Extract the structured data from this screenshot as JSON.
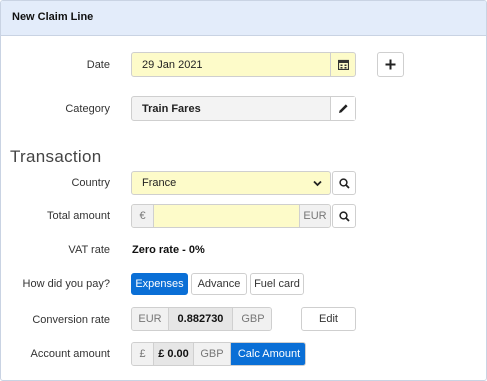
{
  "panel": {
    "title": "New Claim Line"
  },
  "date": {
    "label": "Date",
    "value": "29 Jan 2021",
    "calendar_icon": "calendar-icon",
    "add_icon": "plus-icon"
  },
  "category": {
    "label": "Category",
    "value": "Train Fares",
    "edit_icon": "pencil-icon"
  },
  "transaction": {
    "heading": "Transaction"
  },
  "country": {
    "label": "Country",
    "value": "France",
    "dropdown_icon": "chevron-down-icon",
    "search_icon": "search-icon"
  },
  "total_amount": {
    "label": "Total amount",
    "currency_symbol": "€",
    "value": "",
    "currency_code": "EUR",
    "search_icon": "search-icon"
  },
  "vat_rate": {
    "label": "VAT rate",
    "value": "Zero rate - 0%"
  },
  "payment": {
    "label": "How did you pay?",
    "options": [
      "Expenses",
      "Advance",
      "Fuel card"
    ],
    "selected": "Expenses"
  },
  "conversion": {
    "label": "Conversion rate",
    "from": "EUR",
    "rate": "0.882730",
    "to": "GBP",
    "edit_label": "Edit"
  },
  "account_amount": {
    "label": "Account amount",
    "symbol": "£",
    "value": "£ 0.00",
    "currency": "GBP",
    "calc_label": "Calc Amount"
  },
  "colors": {
    "accent": "#0a6fd6",
    "field_yellow": "#fdfbc9",
    "header_bg": "#e3ecfa"
  }
}
